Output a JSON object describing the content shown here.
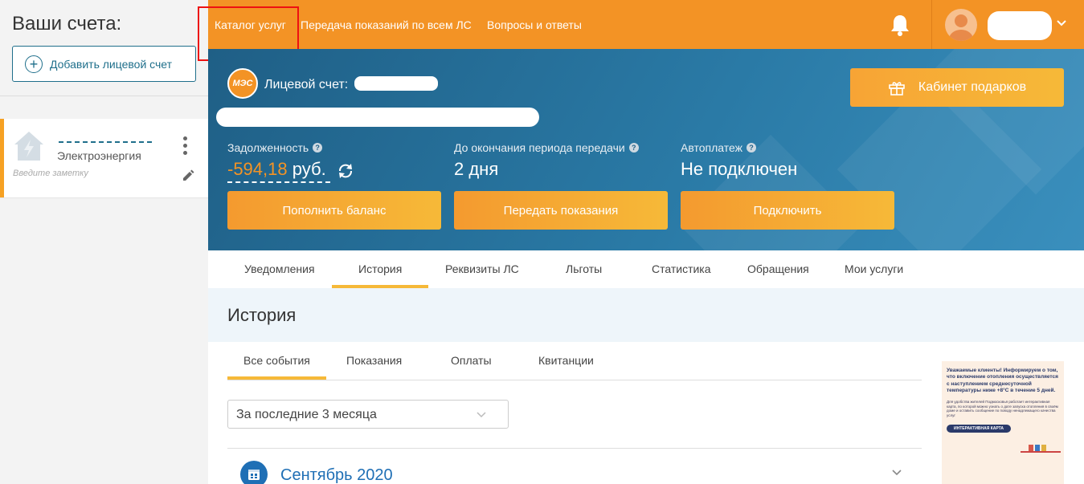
{
  "sidebar": {
    "title": "Ваши счета:",
    "add_button": "Добавить лицевой счет",
    "account": {
      "type": "Электроэнергия",
      "note_placeholder": "Введите заметку"
    }
  },
  "topbar": {
    "nav": [
      {
        "label": "Каталог услуг"
      },
      {
        "label": "Передача показаний по всем ЛС"
      },
      {
        "label": "Вопросы и ответы"
      }
    ],
    "accent": "#f39325"
  },
  "hero": {
    "logo_text": "МЭС",
    "account_label": "Лицевой счет:",
    "gift_button": "Кабинет подарков",
    "debt": {
      "label": "Задолженность",
      "amount": "-594,18",
      "currency": "руб."
    },
    "period": {
      "label": "До окончания периода передачи",
      "value": "2 дня"
    },
    "autopay": {
      "label": "Автоплатеж",
      "value": "Не подключен"
    },
    "buttons": {
      "topup": "Пополнить баланс",
      "submit": "Передать показания",
      "connect": "Подключить"
    }
  },
  "tabs": [
    {
      "label": "Уведомления"
    },
    {
      "label": "История",
      "active": true
    },
    {
      "label": "Реквизиты ЛС"
    },
    {
      "label": "Льготы"
    },
    {
      "label": "Статистика"
    },
    {
      "label": "Обращения"
    },
    {
      "label": "Мои услуги"
    }
  ],
  "history": {
    "title": "История",
    "subtabs": [
      {
        "label": "Все события",
        "active": true
      },
      {
        "label": "Показания"
      },
      {
        "label": "Оплаты"
      },
      {
        "label": "Квитанции"
      }
    ],
    "period_select": "За последние 3 месяца",
    "month": "Сентябрь 2020"
  },
  "promo": {
    "heading": "Уважаемые клиенты! Информируем о том, что включение отопления осуществляется с наступлением среднесуточной температуры ниже +8°С в течение 5 дней.",
    "text": "Для удобства жителей Подмосковья работает интерактивная карта, по которой можно узнать о дате запуска отопления в своём доме и оставить сообщение по поводу ненадлежащего качества услуг",
    "button": "ИНТЕРАКТИВНАЯ КАРТА"
  }
}
